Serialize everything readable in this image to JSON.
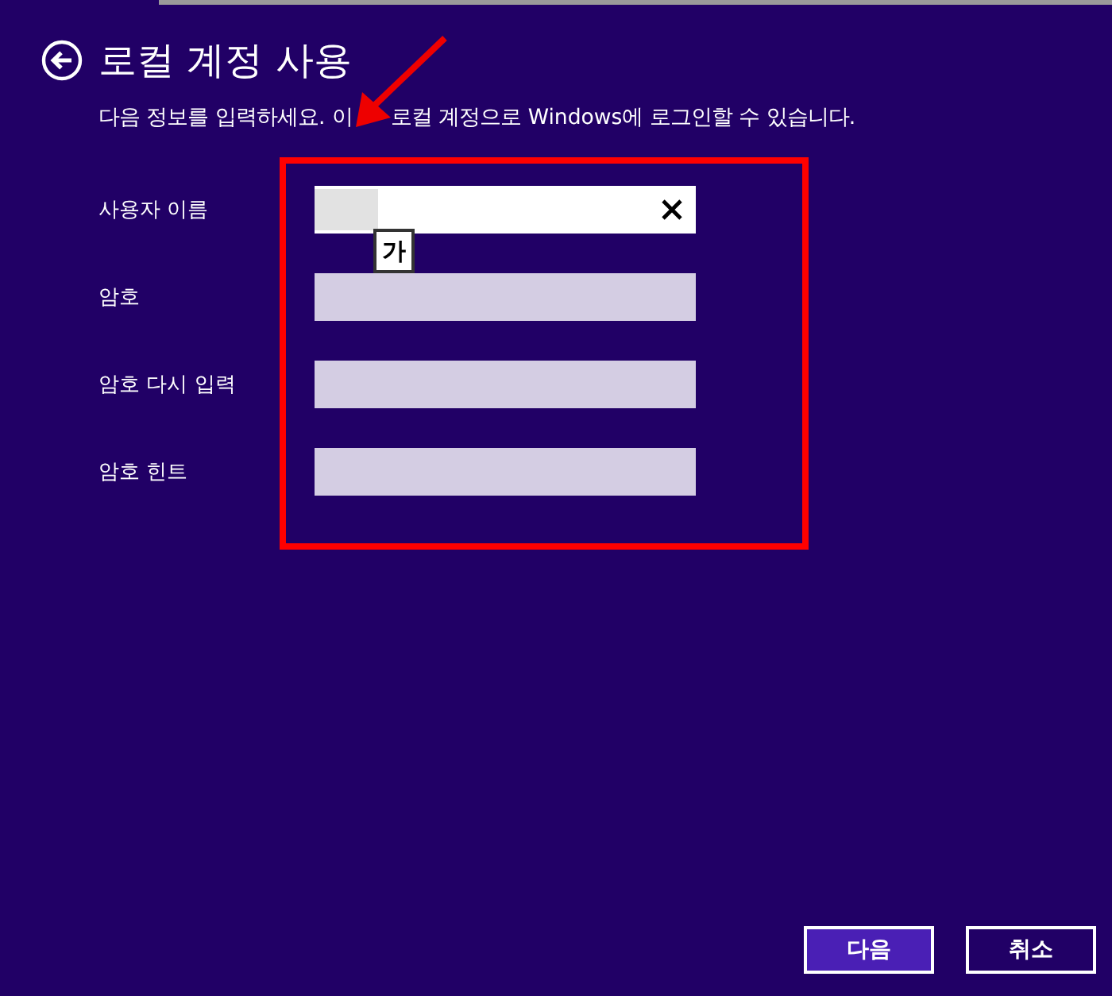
{
  "title": "로컬 계정 사용",
  "subtitle": [
    "다음 정보를 입력하세요. 이",
    "로컬 계정으로 Windows에 로그인할 수 있습니다."
  ],
  "fields": [
    {
      "label": "사용자 이름",
      "focused": true
    },
    {
      "label": "암호",
      "focused": false
    },
    {
      "label": "암호 다시 입력",
      "focused": false
    },
    {
      "label": "암호 힌트",
      "focused": false
    }
  ],
  "ime_indicator": "가",
  "buttons": [
    {
      "label": "다음",
      "kind": "primary"
    },
    {
      "label": "취소",
      "kind": "secondary"
    }
  ]
}
